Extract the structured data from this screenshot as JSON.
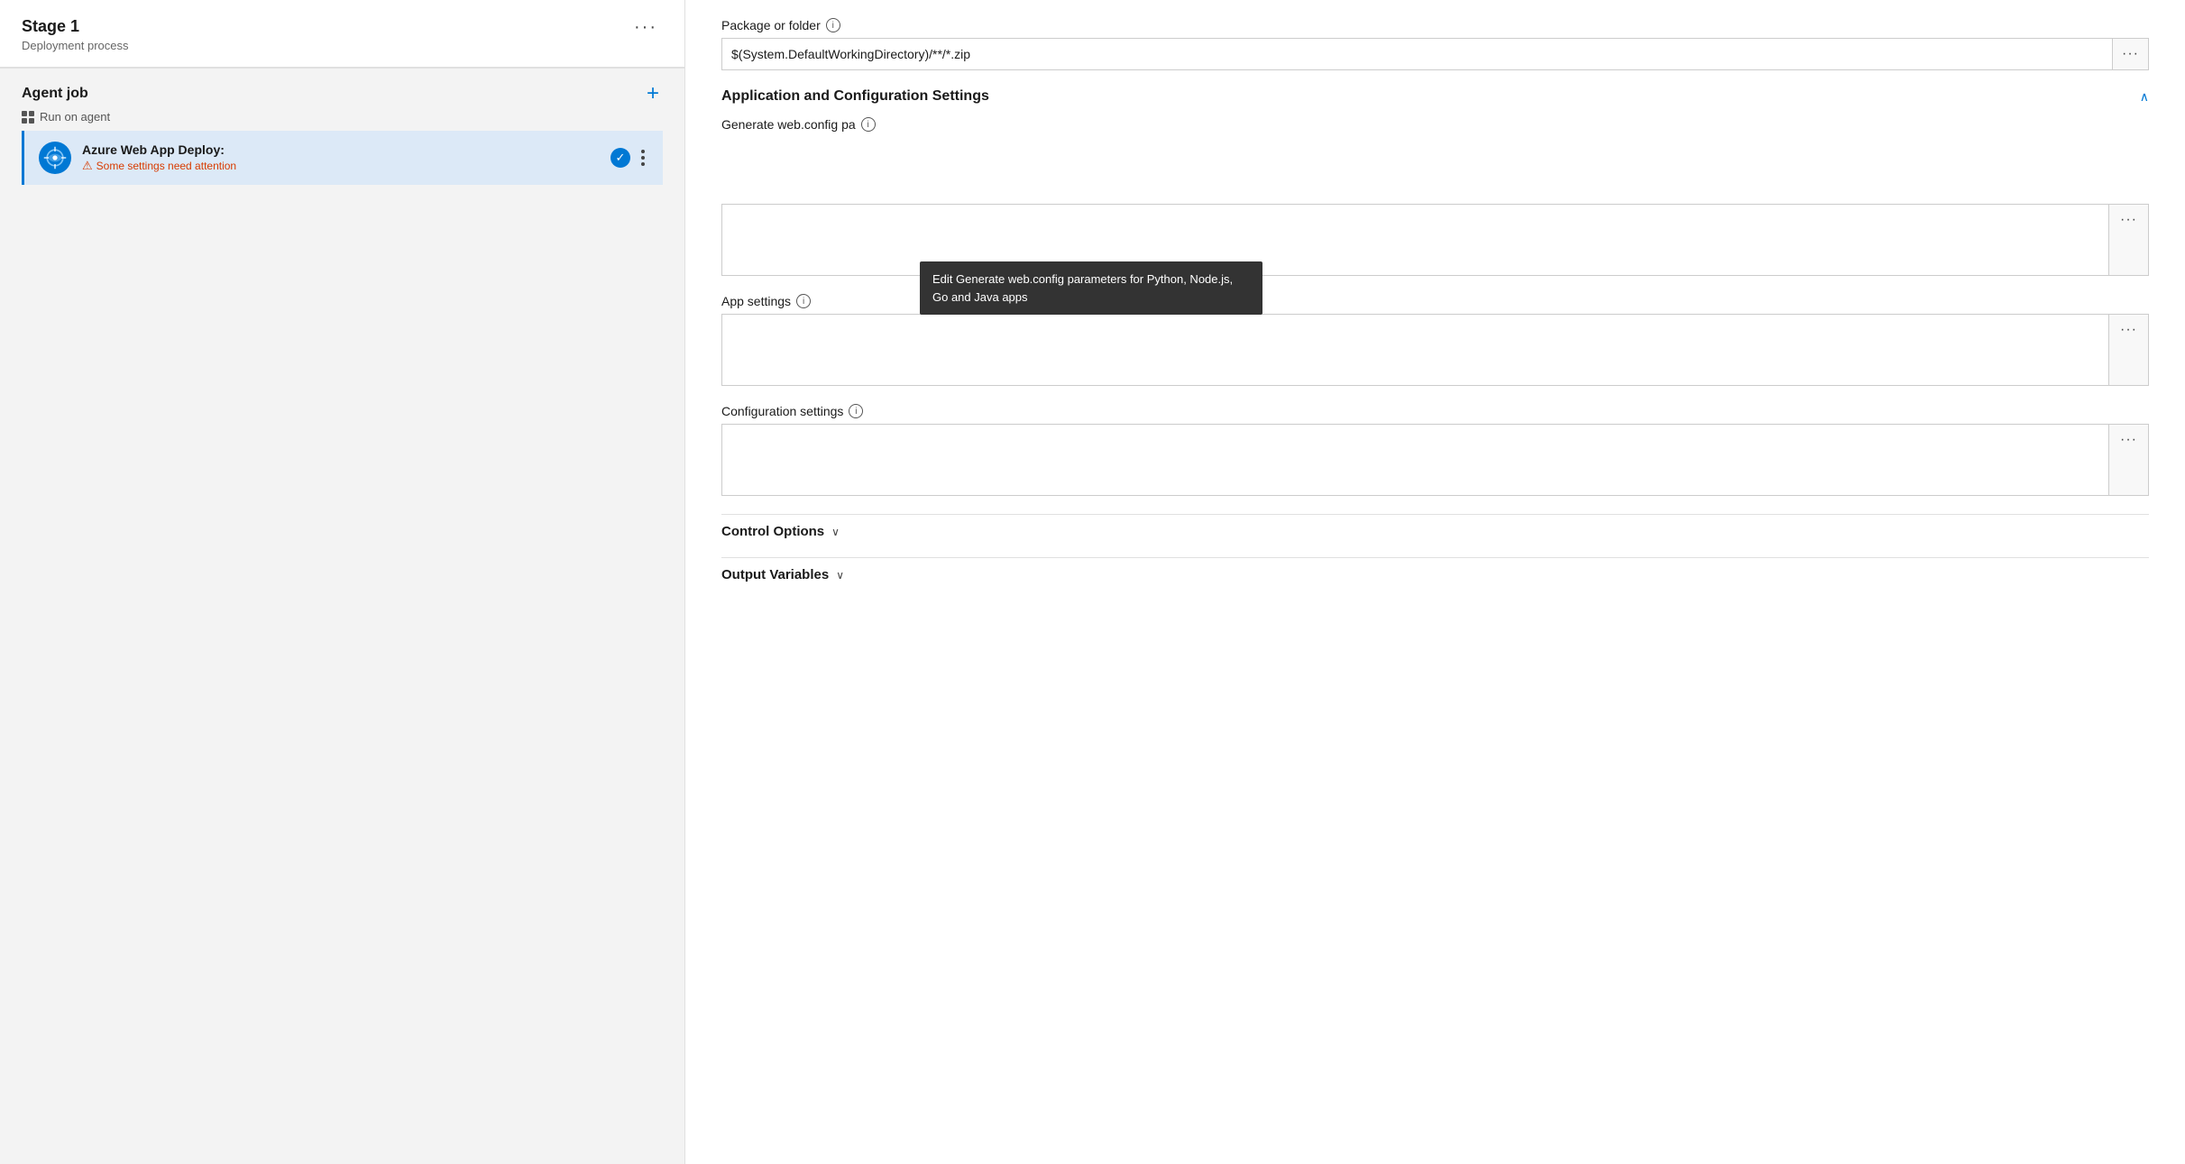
{
  "leftPanel": {
    "stageTitle": "Stage 1",
    "stageSubtitle": "Deployment process",
    "moreButtonLabel": "···",
    "agentJob": {
      "title": "Agent job",
      "subtitle": "Run on agent",
      "addButtonLabel": "+"
    },
    "task": {
      "name": "Azure Web App Deploy:",
      "warning": "Some settings need attention"
    }
  },
  "rightPanel": {
    "packageSection": {
      "label": "Package or folder",
      "value": "$(System.DefaultWorkingDirectory)/**/*.zip"
    },
    "appConfigSection": {
      "title": "Application and Configuration Settings",
      "expanded": true,
      "generateWebConfig": {
        "label": "Generate web.config pa",
        "tooltip": "Edit Generate web.config parameters for Python, Node.js, Go and Java apps",
        "value": ""
      },
      "appSettings": {
        "label": "App settings",
        "value": ""
      },
      "configSettings": {
        "label": "Configuration settings",
        "value": ""
      }
    },
    "controlOptions": {
      "title": "Control Options",
      "expanded": false
    },
    "outputVariables": {
      "title": "Output Variables",
      "expanded": false
    }
  }
}
